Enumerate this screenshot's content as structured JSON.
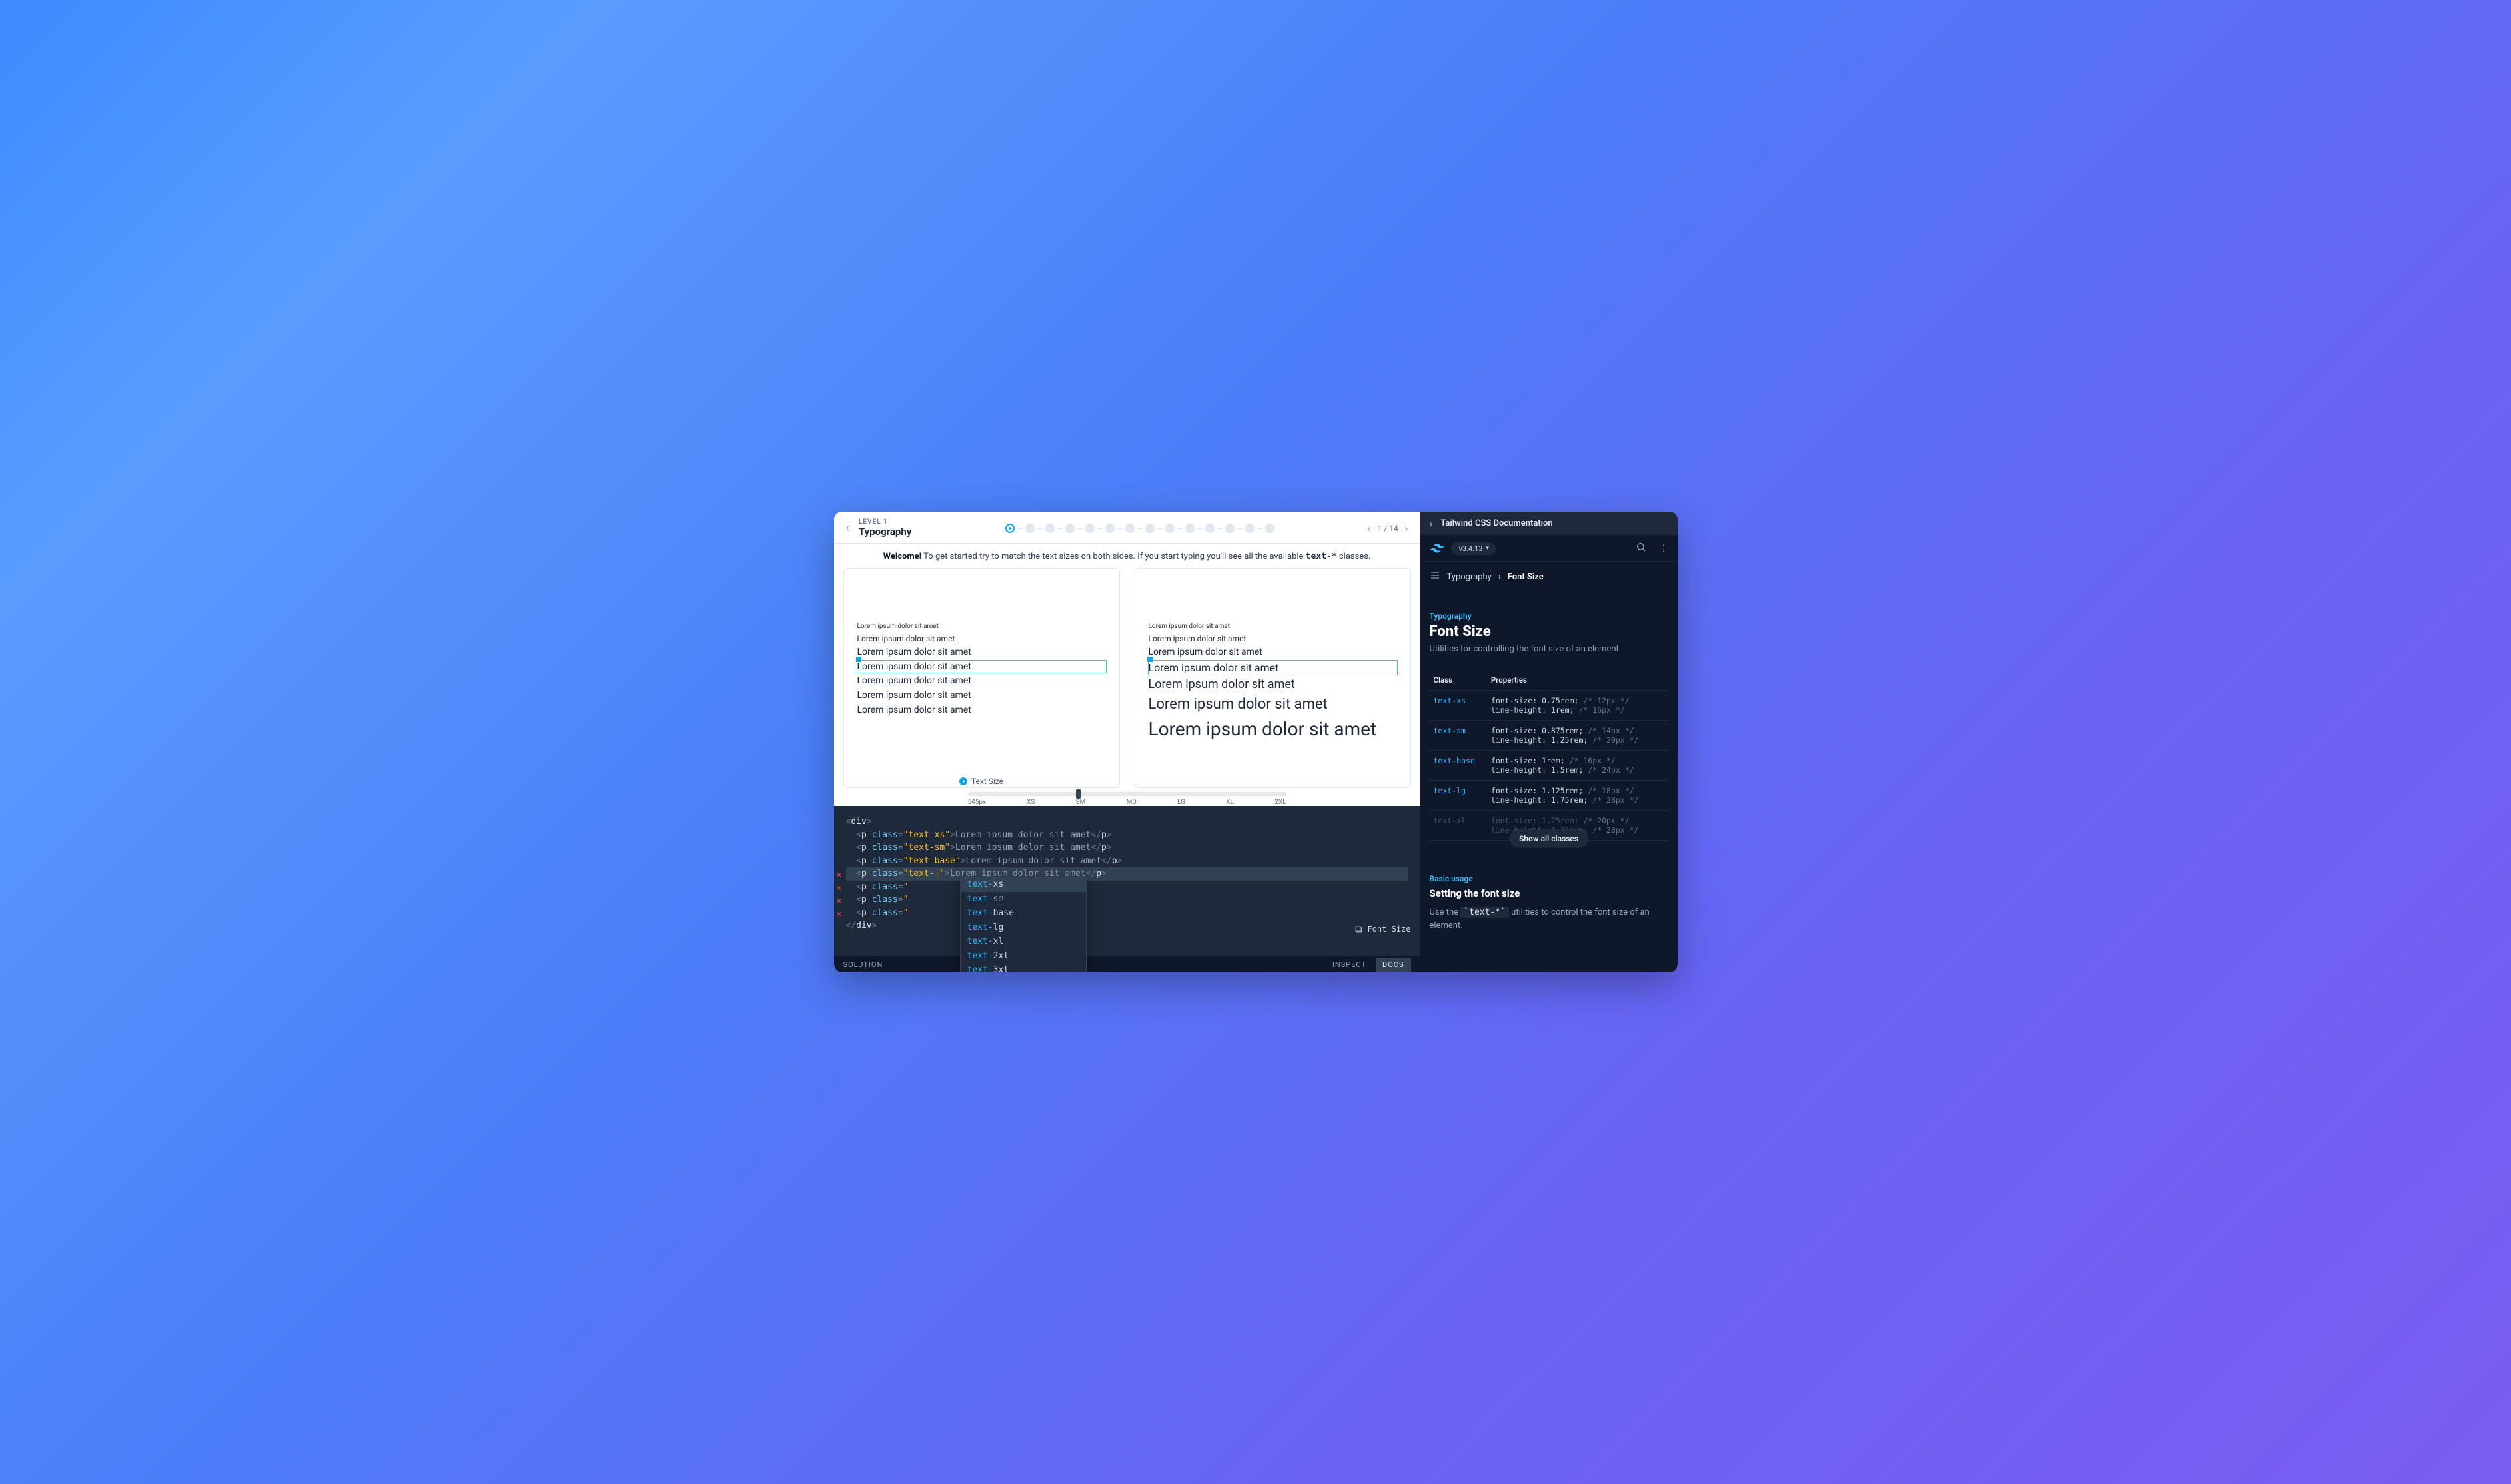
{
  "topbar": {
    "level_label": "LEVEL 1",
    "title": "Typography",
    "progress": "1 / 14"
  },
  "welcome": {
    "bold": "Welcome!",
    "text_a": " To get started try to match the text sizes on both sides. If you start typing you'll see all the available ",
    "code": "text-*",
    "text_b": " classes."
  },
  "lorem": "Lorem ipsum dolor sit amet",
  "panel_label": "Text Size",
  "slider": {
    "labels": [
      "545px",
      "XS",
      "SM",
      "MD",
      "LG",
      "XL",
      "2XL"
    ]
  },
  "code": {
    "tag_name": "p",
    "attr_name": "class",
    "div_open": "div",
    "div_close": "div",
    "lines_good": [
      "text-xs",
      "text-sm",
      "text-base"
    ],
    "cursor_line_value": "text-",
    "lines_err": [
      "",
      "",
      "",
      ""
    ],
    "autocomplete": [
      "xs",
      "sm",
      "base",
      "lg",
      "xl",
      "2xl",
      "3xl"
    ],
    "autocomplete_prefix": "text-",
    "badge": "Font Size"
  },
  "bottombar": {
    "left": "SOLUTION",
    "right": [
      "INSPECT",
      "DOCS"
    ]
  },
  "docs": {
    "header": "Tailwind CSS Documentation",
    "version": "v3.4.13",
    "crumb_a": "Typography",
    "crumb_b": "Font Size",
    "category": "Typography",
    "h1": "Font Size",
    "sub": "Utilities for controlling the font size of an element.",
    "table": {
      "head": [
        "Class",
        "Properties"
      ],
      "rows": [
        {
          "cls": "text-xs",
          "p1": "font-size: 0.75rem;",
          "c1": "/* 12px */",
          "p2": "line-height: 1rem;",
          "c2": "/* 16px */"
        },
        {
          "cls": "text-sm",
          "p1": "font-size: 0.875rem;",
          "c1": "/* 14px */",
          "p2": "line-height: 1.25rem;",
          "c2": "/* 20px */"
        },
        {
          "cls": "text-base",
          "p1": "font-size: 1rem;",
          "c1": "/* 16px */",
          "p2": "line-height: 1.5rem;",
          "c2": "/* 24px */"
        },
        {
          "cls": "text-lg",
          "p1": "font-size: 1.125rem;",
          "c1": "/* 18px */",
          "p2": "line-height: 1.75rem;",
          "c2": "/* 28px */"
        },
        {
          "cls": "text-xl",
          "p1": "font-size: 1.25rem;",
          "c1": "/* 20px */",
          "p2": "line-height: 1.75rem;",
          "c2": "/* 28px */",
          "fade": true
        }
      ]
    },
    "show_all": "Show all classes",
    "section_label": "Basic usage",
    "h2": "Setting the font size",
    "para_a": "Use the ",
    "para_code": "`text-*`",
    "para_b": " utilities to control the font size of an element."
  }
}
